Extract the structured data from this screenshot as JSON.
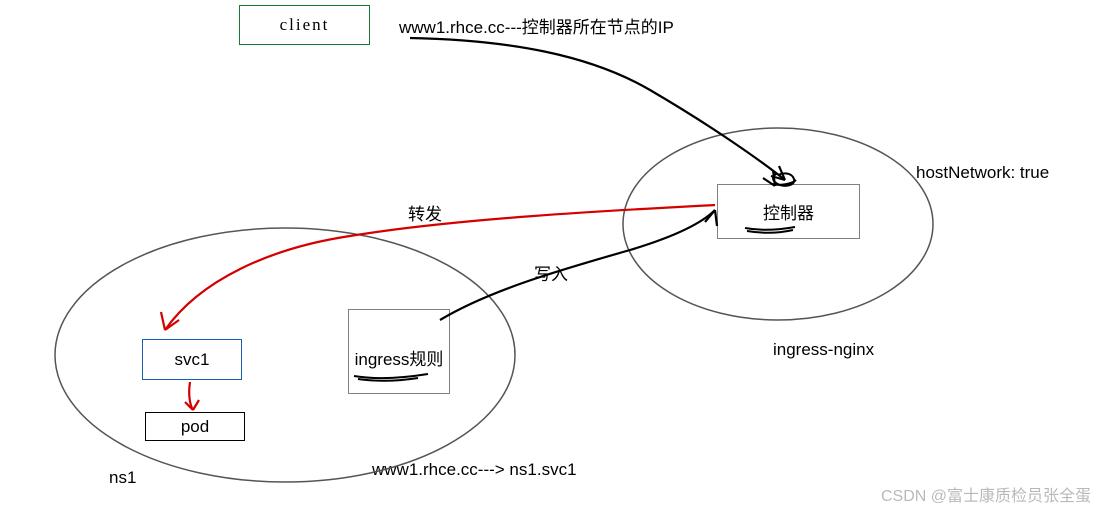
{
  "client": {
    "label": "client"
  },
  "dns_note": "www1.rhce.cc---控制器所在节点的IP",
  "forward_label": "转发",
  "write_label": "写入",
  "controller": {
    "label": "控制器"
  },
  "host_network_label": "hostNetwork: true",
  "ingress_nginx_label": "ingress-nginx",
  "svc1": {
    "label": "svc1"
  },
  "pod": {
    "label": "pod"
  },
  "ingress_rule": {
    "label": "ingress规则"
  },
  "routing_note": "www1.rhce.cc---> ns1.svc1",
  "ns1_label": "ns1",
  "watermark": "CSDN @富士康质检员张全蛋"
}
